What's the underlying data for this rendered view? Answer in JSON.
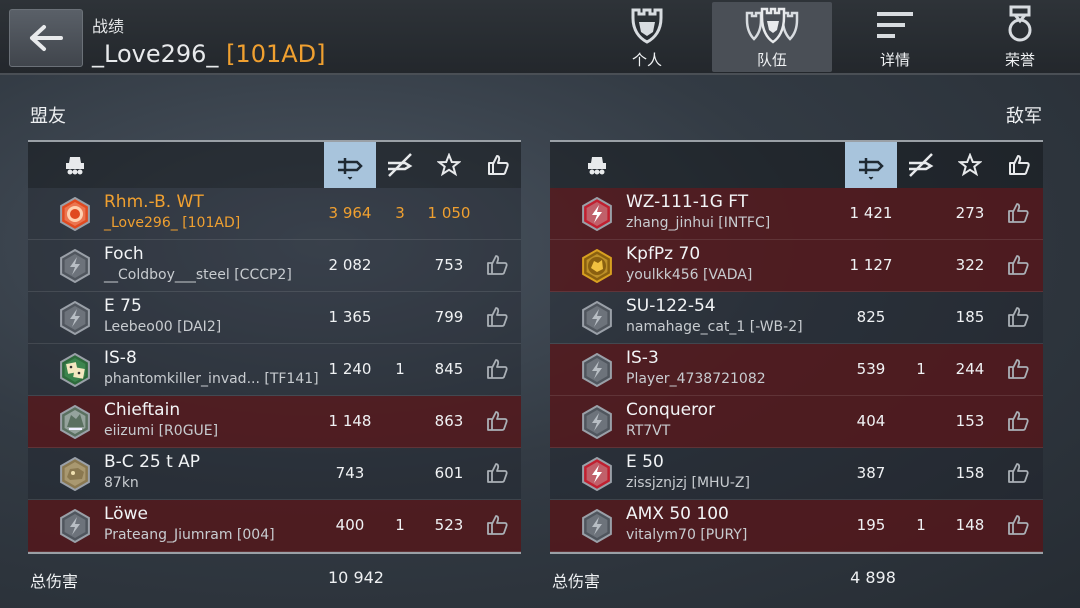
{
  "header": {
    "subtitle": "战绩",
    "player_name": "_Love296_",
    "clan_tag": "[101AD]"
  },
  "nav_tabs": [
    {
      "label": "个人",
      "icon": "helmet-icon"
    },
    {
      "label": "队伍",
      "icon": "team-icon",
      "active": true
    },
    {
      "label": "详情",
      "icon": "list-icon"
    },
    {
      "label": "荣誉",
      "icon": "medal-icon"
    }
  ],
  "allies": {
    "title": "盟友",
    "total_label": "总伤害",
    "total_damage": "10 942",
    "rows": [
      {
        "tank": "Rhm.-B. WT",
        "player": "_Love296_ [101AD]",
        "damage": "3 964",
        "kills": "3",
        "xp": "1 050",
        "icon": "orange-hex-icon",
        "highlight": false,
        "me": true
      },
      {
        "tank": "Foch",
        "player": "__Coldboy___steel [CCCP2]",
        "damage": "2 082",
        "kills": "",
        "xp": "753",
        "icon": "gray-hex-icon",
        "highlight": false
      },
      {
        "tank": "E 75",
        "player": "Leebeo00 [DAI2]",
        "damage": "1 365",
        "kills": "",
        "xp": "799",
        "icon": "gray-hex-icon",
        "highlight": false
      },
      {
        "tank": "IS-8",
        "player": "phantomkiller_invad...  [TF141]",
        "damage": "1 240",
        "kills": "1",
        "xp": "845",
        "icon": "dice-icon",
        "highlight": false
      },
      {
        "tank": "Chieftain",
        "player": "eiizumi [R0GUE]",
        "damage": "1 148",
        "kills": "",
        "xp": "863",
        "icon": "green-camo-icon",
        "highlight": true
      },
      {
        "tank": "B-C 25 t AP",
        "player": "87kn",
        "damage": "743",
        "kills": "",
        "xp": "601",
        "icon": "tan-emblem-icon",
        "highlight": false
      },
      {
        "tank": "Löwe",
        "player": "Prateang_Jiumram [004]",
        "damage": "400",
        "kills": "1",
        "xp": "523",
        "icon": "gray-hex-icon",
        "highlight": true
      }
    ]
  },
  "enemies": {
    "title": "敌军",
    "total_label": "总伤害",
    "total_damage": "4 898",
    "rows": [
      {
        "tank": "WZ-111-1G FT",
        "player": "zhang_jinhui [INTFC]",
        "damage": "1 421",
        "kills": "",
        "xp": "273",
        "icon": "red-hex-icon",
        "highlight": true
      },
      {
        "tank": "KpfPz 70",
        "player": "youlkk456 [VADA]",
        "damage": "1 127",
        "kills": "",
        "xp": "322",
        "icon": "gold-emblem-icon",
        "highlight": true
      },
      {
        "tank": "SU-122-54",
        "player": "namahage_cat_1 [-WB-2]",
        "damage": "825",
        "kills": "",
        "xp": "185",
        "icon": "gray-hex-icon",
        "highlight": false
      },
      {
        "tank": "IS-3",
        "player": "Player_4738721082",
        "damage": "539",
        "kills": "1",
        "xp": "244",
        "icon": "gray-hex-icon",
        "highlight": true
      },
      {
        "tank": "Conqueror",
        "player": "RT7VT",
        "damage": "404",
        "kills": "",
        "xp": "153",
        "icon": "gray-hex-icon",
        "highlight": true
      },
      {
        "tank": "E 50",
        "player": "zissjznjzj [MHU-Z]",
        "damage": "387",
        "kills": "",
        "xp": "158",
        "icon": "red-hex-icon",
        "highlight": false
      },
      {
        "tank": "AMX 50 100",
        "player": "vitalym70 [PURY]",
        "damage": "195",
        "kills": "1",
        "xp": "148",
        "icon": "gray-hex-icon",
        "highlight": true
      }
    ]
  },
  "colors": {
    "accent_orange": "#f0a030",
    "row_highlight": "#54161a",
    "selected_column": "#a8c4dc"
  }
}
